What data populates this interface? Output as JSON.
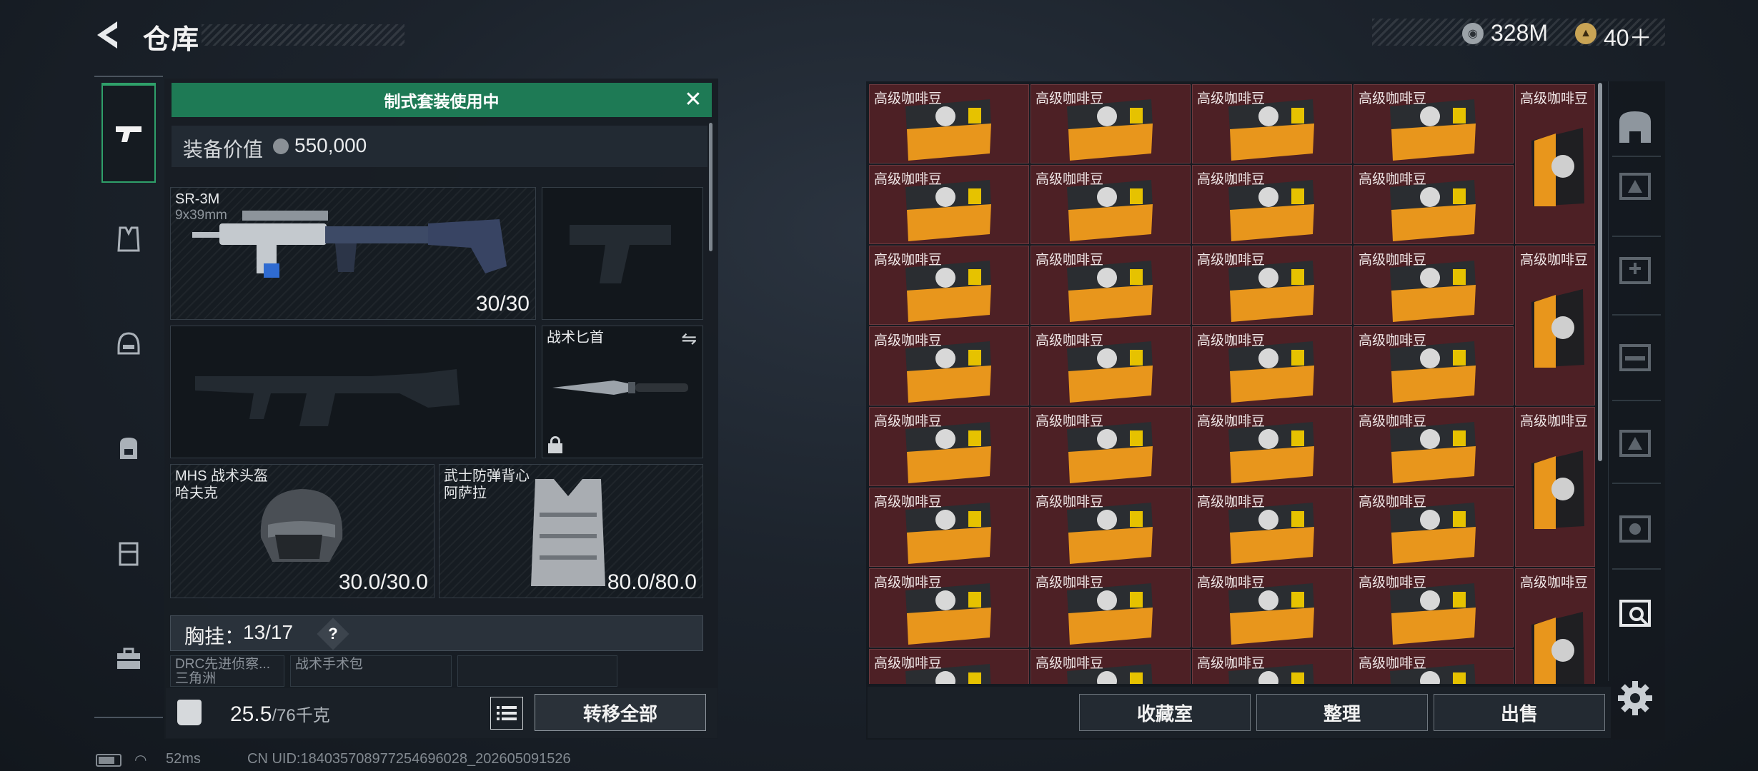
{
  "header": {
    "title": "仓库"
  },
  "currency": {
    "coins": "328M",
    "tickets": "40＋"
  },
  "equipment": {
    "banner": "制式套装使用中",
    "value_label": "装备价值",
    "value_amount": "550,000",
    "primary_weapon": {
      "name": "SR-3M",
      "caliber": "9x39mm",
      "ammo": "30/30"
    },
    "knife": {
      "name": "战术匕首"
    },
    "helmet": {
      "name": "MHS 战术头盔",
      "variant": "哈夫克",
      "durability": "30.0/30.0"
    },
    "armor": {
      "name": "武士防弹背心",
      "variant": "阿萨拉",
      "durability": "80.0/80.0"
    },
    "chest_rig": {
      "label": "胸挂：",
      "count": "13/17",
      "help": "?"
    },
    "sub_slots": [
      {
        "line1": "DRC先进侦察...",
        "line2": "三角洲"
      },
      {
        "line1": "战术手术包",
        "line2": ""
      }
    ],
    "weight": {
      "current": "25.5",
      "max": "/76千克"
    },
    "transfer_all": "转移全部"
  },
  "storage": {
    "item_label": "高级咖啡豆",
    "actions": {
      "collection": "收藏室",
      "sort": "整理",
      "sell": "出售"
    }
  },
  "status": {
    "ping": "52ms",
    "uid": "CN UID:18403570897725469602​8_202605091526"
  },
  "colors": {
    "accent": "#1e7a55",
    "cell": "#4d2025",
    "coffee_orange": "#e8961c"
  }
}
